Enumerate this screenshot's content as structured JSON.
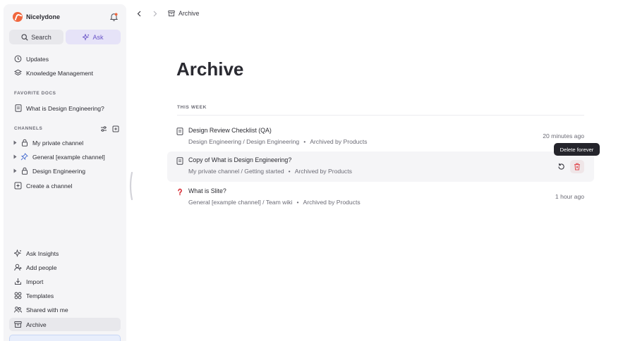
{
  "workspace": {
    "name": "Nicelydone"
  },
  "sidebar": {
    "search_label": "Search",
    "ask_label": "Ask",
    "top_items": [
      {
        "label": "Updates",
        "icon": "clock-icon"
      },
      {
        "label": "Knowledge Management",
        "icon": "layers-icon"
      }
    ],
    "favorites_label": "FAVORITE DOCS",
    "favorites": [
      {
        "label": "What is Design Engineering?",
        "icon": "doc-icon"
      }
    ],
    "channels_label": "CHANNELS",
    "channels": [
      {
        "label": "My private channel",
        "icon": "lock-icon"
      },
      {
        "label": "General [example channel]",
        "icon": "pin-icon"
      },
      {
        "label": "Design Engineering",
        "icon": "lock-icon"
      }
    ],
    "create_channel_label": "Create a channel",
    "bottom_items": [
      {
        "label": "Ask Insights",
        "icon": "sparkle-icon"
      },
      {
        "label": "Add people",
        "icon": "add-user-icon"
      },
      {
        "label": "Import",
        "icon": "import-icon"
      },
      {
        "label": "Templates",
        "icon": "templates-icon"
      },
      {
        "label": "Shared with me",
        "icon": "shared-icon"
      },
      {
        "label": "Archive",
        "icon": "archive-icon",
        "active": true
      }
    ]
  },
  "topbar": {
    "breadcrumb": "Archive"
  },
  "main": {
    "title": "Archive",
    "group_label": "THIS WEEK",
    "rows": [
      {
        "title": "Design Review Checklist (QA)",
        "path": "Design Engineering / Design Engineering",
        "archived_by": "Archived by Products",
        "time": "20 minutes ago",
        "icon": "doc-icon"
      },
      {
        "title": "Copy of What is Design Engineering?",
        "path": "My private channel / Getting started",
        "archived_by": "Archived by Products",
        "time": "",
        "icon": "doc-icon"
      },
      {
        "title": "What is Slite?",
        "path": "General [example channel] / Team wiki",
        "archived_by": "Archived by Products",
        "time": "1 hour ago",
        "icon": "question-mark-icon"
      }
    ],
    "tooltip": "Delete forever"
  },
  "colors": {
    "accent": "#6a55c8",
    "brand": "#f0663d",
    "danger": "#e0484e"
  }
}
